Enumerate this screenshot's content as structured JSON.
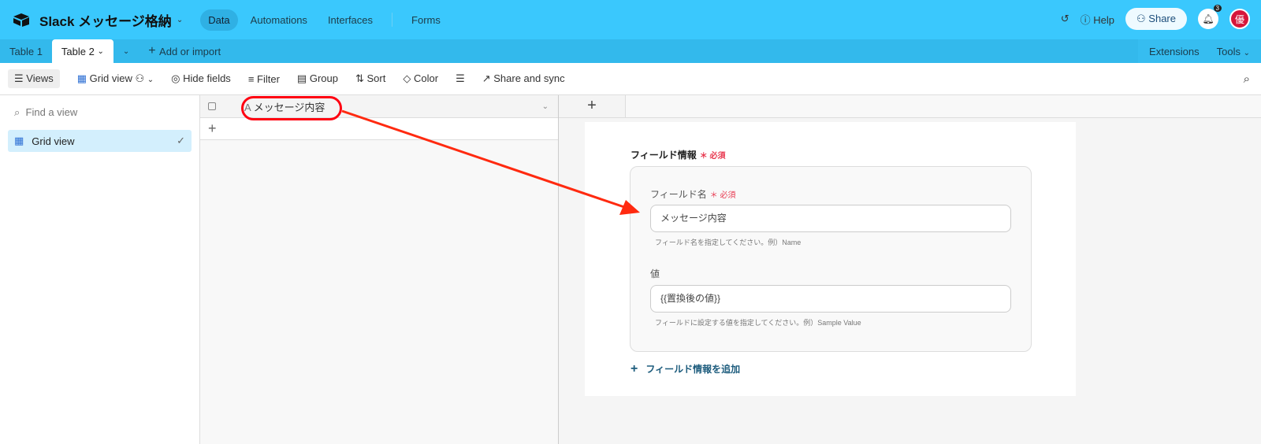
{
  "header": {
    "base_name": "Slack メッセージ格納",
    "nav": [
      "Data",
      "Automations",
      "Interfaces",
      "Forms"
    ],
    "help": "Help",
    "share": "Share",
    "notification_count": "3",
    "avatar": "優"
  },
  "tabs": {
    "items": [
      "Table 1",
      "Table 2"
    ],
    "add": "Add or import",
    "extensions": "Extensions",
    "tools": "Tools"
  },
  "toolbar": {
    "views": "Views",
    "grid_view": "Grid view",
    "hide_fields": "Hide fields",
    "filter": "Filter",
    "group": "Group",
    "sort": "Sort",
    "color": "Color",
    "share_sync": "Share and sync"
  },
  "sidebar": {
    "find_placeholder": "Find a view",
    "views": [
      "Grid view"
    ]
  },
  "grid": {
    "column": "メッセージ内容"
  },
  "form": {
    "section": "フィールド情報",
    "required": "＊ 必須",
    "field_name_label": "フィールド名",
    "field_name_value": "メッセージ内容",
    "field_name_hint": "フィールド名を指定してください。例）Name",
    "value_label": "値",
    "value_value": "{{置換後の値}}",
    "value_hint": "フィールドに設定する値を指定してください。例）Sample Value",
    "add_field": "フィールド情報を追加"
  },
  "colors": {
    "header": "#3ac8fd",
    "annotation": "#ff2200"
  }
}
